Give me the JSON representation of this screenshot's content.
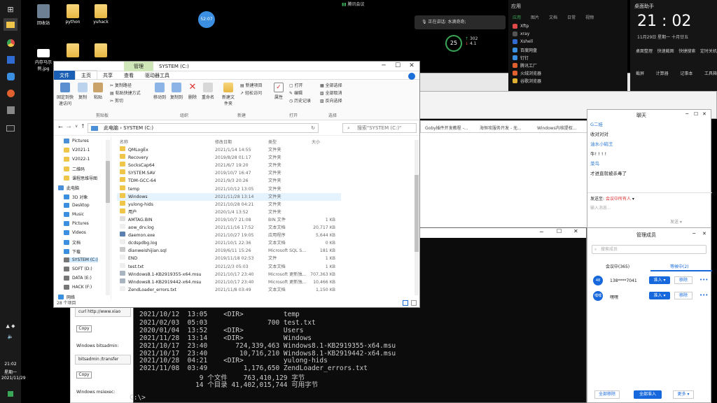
{
  "taskbar": {
    "time": "21:02",
    "weekday": "星期一",
    "date": "2021/11/29"
  },
  "desktop": {
    "icons": [
      {
        "label": "回收站",
        "color": "#6d7f93"
      },
      {
        "label": "python",
        "color": "#f0c64a"
      },
      {
        "label": "yuhack",
        "color": "#f0c64a"
      },
      {
        "label": "内存马示例.jpg",
        "color": "#ffffff"
      }
    ],
    "clock_bubble": "52:07",
    "meeting_label": "腾讯会议",
    "speaking": "正在讲话: 水滴奇奇;",
    "perf_percent": "25",
    "perf_up": "302",
    "perf_down": "4.1"
  },
  "browser_tabs": [
    "Goby插件开发教程 -...",
    "海恒攻服务开发 - 无...",
    "Windows内核提权..."
  ],
  "explorer": {
    "tab_manage": "管理",
    "title": "SYSTEM (C:)",
    "ribbon_tabs": [
      "文件",
      "主页",
      "共享",
      "查看",
      "驱动器工具"
    ],
    "ribbon": {
      "pin": "固定到快速访问",
      "copy": "复制",
      "paste": "粘贴",
      "copy_path": "复制路径",
      "paste_shortcut": "粘贴快捷方式",
      "cut": "剪切",
      "move_to": "移动到",
      "copy_to": "复制到",
      "delete": "删除",
      "rename": "重命名",
      "new_folder": "新建文件夹",
      "new_item": "新建项目",
      "easy_access": "轻松访问",
      "properties": "属性",
      "open": "打开",
      "edit": "编辑",
      "history": "历史记录",
      "select_all": "全部选择",
      "select_none": "全部取消",
      "invert": "反向选择",
      "group_clipboard": "剪贴板",
      "group_organize": "组织",
      "group_new": "新建",
      "group_open": "打开",
      "group_select": "选择"
    },
    "address": [
      "此电脑",
      "SYSTEM (C:)"
    ],
    "search_placeholder": "搜索\"SYSTEM (C:)\"",
    "nav": [
      {
        "label": "Pictures",
        "icon": "#4a8fd8"
      },
      {
        "label": "V2021-1",
        "icon": "#f0c64a"
      },
      {
        "label": "V2022-1",
        "icon": "#f0c64a"
      },
      {
        "label": "二维码",
        "icon": "#f0c64a"
      },
      {
        "label": "课程思维导图",
        "icon": "#f0c64a"
      },
      {
        "label": "此电脑",
        "icon": "#4a8fd8"
      },
      {
        "label": "3D 对象",
        "icon": "#3a8fe0"
      },
      {
        "label": "Desktop",
        "icon": "#3a8fe0"
      },
      {
        "label": "Music",
        "icon": "#3a8fe0"
      },
      {
        "label": "Pictures",
        "icon": "#3a8fe0"
      },
      {
        "label": "Videos",
        "icon": "#3a8fe0"
      },
      {
        "label": "文档",
        "icon": "#3a8fe0"
      },
      {
        "label": "下载",
        "icon": "#3a8fe0"
      },
      {
        "label": "SYSTEM (C:)",
        "icon": "#777777"
      },
      {
        "label": "SOFT (D:)",
        "icon": "#777777"
      },
      {
        "label": "DATA (E:)",
        "icon": "#777777"
      },
      {
        "label": "HACK (F:)",
        "icon": "#777777"
      },
      {
        "label": "网络",
        "icon": "#3a8fe0"
      }
    ],
    "columns": {
      "name": "名称",
      "date": "修改日期",
      "type": "类型",
      "size": "大小"
    },
    "files": [
      {
        "name": "QMLogEx",
        "date": "2021/1/14 14:55",
        "type": "文件夹",
        "size": "",
        "icon": "#f0c64a"
      },
      {
        "name": "Recovery",
        "date": "2019/8/28 01:17",
        "type": "文件夹",
        "size": "",
        "icon": "#f0c64a"
      },
      {
        "name": "SocksCap64",
        "date": "2021/6/7 19:20",
        "type": "文件夹",
        "size": "",
        "icon": "#f0c64a"
      },
      {
        "name": "SYSTEM.SAV",
        "date": "2019/10/7 16:47",
        "type": "文件夹",
        "size": "",
        "icon": "#f0c64a"
      },
      {
        "name": "TDM-GCC-64",
        "date": "2021/9/3 20:26",
        "type": "文件夹",
        "size": "",
        "icon": "#f0c64a"
      },
      {
        "name": "temp",
        "date": "2021/10/12 13:05",
        "type": "文件夹",
        "size": "",
        "icon": "#f0c64a"
      },
      {
        "name": "Windows",
        "date": "2021/11/28 13:14",
        "type": "文件夹",
        "size": "",
        "icon": "#f0c64a"
      },
      {
        "name": "yulong-hids",
        "date": "2021/10/28 04:21",
        "type": "文件夹",
        "size": "",
        "icon": "#f0c64a"
      },
      {
        "name": "用户",
        "date": "2020/1/4 13:52",
        "type": "文件夹",
        "size": "",
        "icon": "#f0c64a"
      },
      {
        "name": "AMTAG.BIN",
        "date": "2019/10/7 21:08",
        "type": "BIN 文件",
        "size": "1 KB",
        "icon": "#dddddd"
      },
      {
        "name": "aow_drv.log",
        "date": "2021/11/16 17:52",
        "type": "文本文档",
        "size": "20,717 KB",
        "icon": "#eeeeee"
      },
      {
        "name": "daemon.exe",
        "date": "2021/10/27 19:05",
        "type": "应用程序",
        "size": "5,644 KB",
        "icon": "#5a7fb0"
      },
      {
        "name": "dcdspdbg.log",
        "date": "2021/10/1 22:36",
        "type": "文本文档",
        "size": "0 KB",
        "icon": "#eeeeee"
      },
      {
        "name": "dianweishijian.sql",
        "date": "2019/6/11 15:26",
        "type": "Microsoft SQL S...",
        "size": "181 KB",
        "icon": "#c9c9c9"
      },
      {
        "name": "END",
        "date": "2019/11/18 02:53",
        "type": "文件",
        "size": "1 KB",
        "icon": "#eeeeee"
      },
      {
        "name": "test.txt",
        "date": "2021/2/3 05:03",
        "type": "文本文档",
        "size": "1 KB",
        "icon": "#eeeeee"
      },
      {
        "name": "Windows8.1-KB2919355-x64.msu",
        "date": "2021/10/17 23:40",
        "type": "Microsoft 更新独...",
        "size": "707,363 KB",
        "icon": "#aab4c0"
      },
      {
        "name": "Windows8.1-KB2919442-x64.msu",
        "date": "2021/10/17 23:40",
        "type": "Microsoft 更新独...",
        "size": "10,466 KB",
        "icon": "#aab4c0"
      },
      {
        "name": "ZendLoader_errors.txt",
        "date": "2021/11/8 03:49",
        "type": "文本文档",
        "size": "1,150 KB",
        "icon": "#eeeeee"
      }
    ],
    "selected_index": 6,
    "status": "28 个项目"
  },
  "cmd": {
    "lines": [
      "2021/10/12  13:05    <DIR>          temp",
      "2021/02/03  05:03               700 test.txt",
      "2020/01/04  13:52    <DIR>          Users",
      "2021/11/28  13:14    <DIR>          Windows",
      "2021/10/17  23:40       724,339,463 Windows8.1-KB2919355-x64.msu",
      "2021/10/17  23:40        10,716,210 Windows8.1-KB2919442-x64.msu",
      "2021/10/28  04:21    <DIR>          yulong-hids",
      "2021/11/08  03:49         1,176,650 ZendLoader_errors.txt",
      "               9 个文件    763,410,129 字节",
      "              14 个目录 41,402,015,744 可用字节",
      "",
      "C:\\>"
    ]
  },
  "left_doc": {
    "copy1": "Copy",
    "copy2": "Copy",
    "curl": "curl http://www.xiao",
    "bitsadmin_title": "Windows bitsadmin:",
    "bitsadmin_cmd": "bitsadmin /transfer",
    "msiexec_title": "Windows msiexec:"
  },
  "chat": {
    "title": "聊天",
    "messages": [
      {
        "text": "G二娃",
        "color": "#2a7ad6"
      },
      {
        "text": "收对对对",
        "color": "#222222"
      },
      {
        "text": "油水小硝王",
        "color": "#2a7ad6"
      },
      {
        "text": "牛! ! ! !",
        "color": "#222222"
      },
      {
        "text": "菜鸟",
        "color": "#2a7ad6"
      },
      {
        "text": "才进直就被杀毒了",
        "color": "#222222"
      }
    ],
    "send_to_label": "发送至:",
    "send_to_value": "会议中所有人",
    "input_placeholder": "输入消息...",
    "send_button": "发送"
  },
  "members": {
    "title": "管理成员",
    "search_placeholder": "搜索成员",
    "tab_in": "会议中(365)",
    "tab_waiting": "等候中(2)",
    "rows": [
      {
        "avatar": "48",
        "name": "138****7041",
        "btn": "准入",
        "action": "移除"
      },
      {
        "avatar": "嘿嘿",
        "name": "嘿嘿",
        "btn": "准入",
        "action": "移除"
      }
    ],
    "reject_all": "全部移除",
    "admit_all": "全部准入",
    "more": "更多"
  },
  "applist": {
    "title": "应用",
    "categories": [
      "应用",
      "图片",
      "文档",
      "日常",
      "视频"
    ],
    "apps": [
      {
        "name": "Xftp",
        "color": "#e04848"
      },
      {
        "name": "xray",
        "color": "#555555"
      },
      {
        "name": "Xshell",
        "color": "#2f6bd0"
      },
      {
        "name": "百度网盘",
        "color": "#3a8fe0"
      },
      {
        "name": "钉钉",
        "color": "#3a8fe0"
      },
      {
        "name": "腾讯工厂",
        "color": "#e06030"
      },
      {
        "name": "火绒浏览器",
        "color": "#e06030"
      },
      {
        "name": "谷歌浏览器",
        "color": "#e0b030"
      }
    ]
  },
  "clockpanel": {
    "title": "桌面助手",
    "time": "21 : 02",
    "date": "11月29日 星期一 十月廿五",
    "actions1": [
      "桌面整理",
      "快速截图",
      "快捷搜索",
      "定时关机"
    ],
    "actions2": [
      "截屏",
      "计算器",
      "记事本",
      "工具箱"
    ]
  }
}
